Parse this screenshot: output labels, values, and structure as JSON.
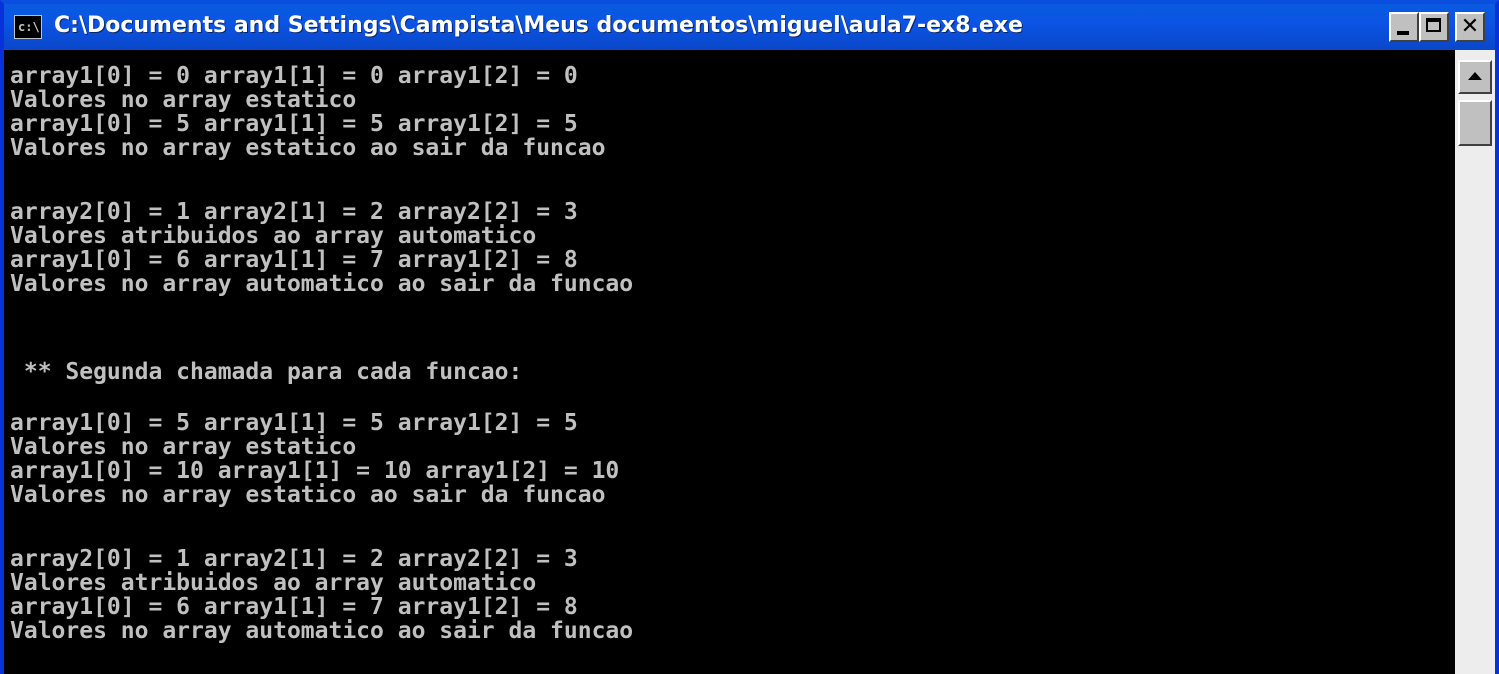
{
  "window": {
    "title": "C:\\Documents and Settings\\Campista\\Meus documentos\\miguel\\aula7-ex8.exe",
    "icon": "console-icon",
    "icon_glyph": "c:\\",
    "buttons": {
      "minimize": "minimize-icon",
      "maximize": "maximize-icon",
      "close": "close-icon",
      "close_glyph": "✕"
    },
    "colors": {
      "titlebar": "#0a5be0",
      "console_bg": "#000000",
      "console_text": "#c0c0c0"
    }
  },
  "console": {
    "lines": [
      "array1[0] = 0 array1[1] = 0 array1[2] = 0",
      "Valores no array estatico",
      "array1[0] = 5 array1[1] = 5 array1[2] = 5",
      "Valores no array estatico ao sair da funcao",
      "array2[0] = 1 array2[1] = 2 array2[2] = 3",
      "Valores atribuidos ao array automatico",
      "array1[0] = 6 array1[1] = 7 array1[2] = 8",
      "Valores no array automatico ao sair da funcao",
      " ** Segunda chamada para cada funcao:",
      "array1[0] = 5 array1[1] = 5 array1[2] = 5",
      "Valores no array estatico",
      "array1[0] = 10 array1[1] = 10 array1[2] = 10",
      "Valores no array estatico ao sair da funcao",
      "array2[0] = 1 array2[1] = 2 array2[2] = 3",
      "Valores atribuidos ao array automatico",
      "array1[0] = 6 array1[1] = 7 array1[2] = 8",
      "Valores no array automatico ao sair da funcao"
    ]
  },
  "scrollbar": {
    "up_icon": "scroll-up-arrow-icon"
  }
}
